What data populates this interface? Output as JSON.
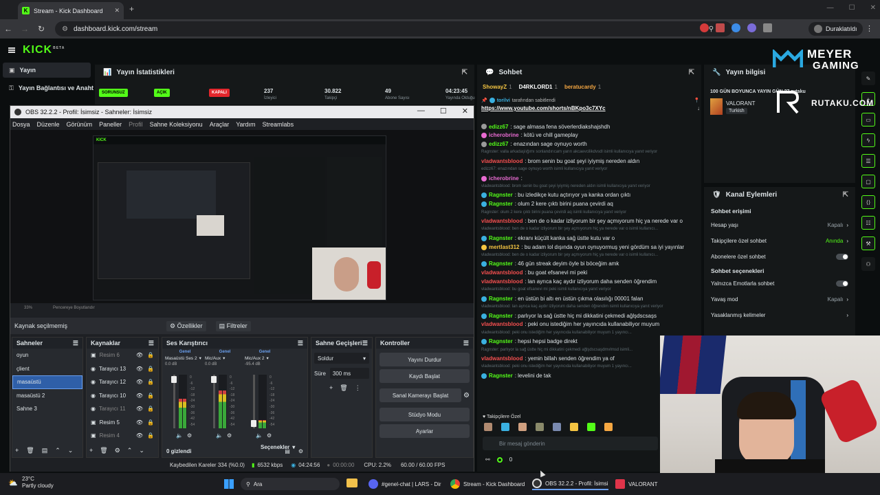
{
  "browser": {
    "tab_title": "Stream - Kick Dashboard",
    "url": "dashboard.kick.com/stream",
    "profile_label": "Duraklatıldı"
  },
  "kick": {
    "logo": "KICK",
    "logo_badge": "BETA",
    "sidebar": {
      "live": "Yayın",
      "connection": "Yayın Bağlantısı ve Anahtar"
    },
    "stats": {
      "title": "Yayın İstatistikleri",
      "badges": [
        "SORUNSUZ",
        "AÇIK",
        "KAPALI"
      ],
      "values": [
        "237",
        "30.822",
        "49",
        "04:23:45"
      ],
      "labels": [
        "İzleyici",
        "Takipçi",
        "Abone Sayısı",
        "Yayında Olduğu"
      ]
    },
    "chat": {
      "title": "Sohbet",
      "top_users": [
        "ShowayZ",
        "D4RKLORD1",
        "beratucardy"
      ],
      "top_counts": [
        "1",
        "1",
        "1"
      ],
      "pinned_by": "torilvi",
      "pinned_text": "tarafından sabitlendi",
      "pinned_link": "https://www.youtube.com/shorts/nBKpo3c7XYc",
      "messages": [
        {
          "u": "edizz67",
          "c": "#53fc18",
          "t": ": sage almasa fena söverlerdiakshajshdh",
          "ic": "#9a9a9a"
        },
        {
          "u": "icherobrine",
          "c": "#e86bd1",
          "t": ": kötü ve chill gameplay",
          "ic": "#e86bd1"
        },
        {
          "u": "edizz67",
          "c": "#53fc18",
          "t": ": enazından sage oynuyo worth",
          "ic": "#9a9a9a"
        },
        {
          "small": "Ragnster: valla arkadaşlığımı sonlandırıcam yarın akcaevcilikdvsdl isimli kullanıcıya yanıt veriyor"
        },
        {
          "u": "vladwantsblood",
          "c": "#f44f4f",
          "t": ": brom senin bu goat şeyi iyiymiş nereden aldın"
        },
        {
          "small": "edizz67: enazından sage oynuyo worth isimli kullanıcıya yanıt veriyor"
        },
        {
          "u": "icherobrine",
          "c": "#e86bd1",
          "t": ":",
          "ic": "#e86bd1"
        },
        {
          "small": "vladwantsblood: brom senin bu goat şeyi iyiymiş nereden aldın isimli kullanıcıya yanıt veriyor"
        },
        {
          "u": "Ragnster",
          "c": "#53fc18",
          "t": ": bu izledikçe kutu açtırıyor ya kanka ordan çıktı",
          "ic": "#3ab0e0"
        },
        {
          "u": "Ragnster",
          "c": "#53fc18",
          "t": ": olum 2 kere çıktı birini puana çevirdi aq",
          "ic": "#3ab0e0"
        },
        {
          "small": "Ragnster: olum 2 kere çıktı birini puana çevirdi aq isimli kullanıcıya yanıt veriyor"
        },
        {
          "u": "vladwantsblood",
          "c": "#f44f4f",
          "t": ": ben de o kadar izliyorum bir şey açmıyorum hiç ya nerede var o"
        },
        {
          "small": "vladwantsblood: ben de o kadar izliyorum bir şey açmıyorum hiç ya nerede var o isimli kullanıcı..."
        },
        {
          "u": "Ragnster",
          "c": "#53fc18",
          "t": ": ekranı küçült kanka sağ üstte kutu var o",
          "ic": "#3ab0e0"
        },
        {
          "u": "mertlast312",
          "c": "#f5c542",
          "t": ": bu adam lol dışında oyun oynuyormuş yeni gördüm sa iyi yayınlar",
          "ic": "#f5c542"
        },
        {
          "small": "vladwantsblood: ben de o kadar izliyorum bir şey açmıyorum hiç ya nerede var o isimli kullanıcı..."
        },
        {
          "u": "Ragnster",
          "c": "#53fc18",
          "t": ": 46 gün streak deyim öyle bi böceğim amk",
          "ic": "#3ab0e0"
        },
        {
          "u": "vladwantsblood",
          "c": "#f44f4f",
          "t": ": bu goat efsanevi mi peki"
        },
        {
          "u": "vladwantsblood",
          "c": "#f44f4f",
          "t": ": lan ayrıca kaç aydır izliyorum daha senden öğrendim"
        },
        {
          "small": "vladwantsblood: bu goat efsanevi mi peki isimli kullanıcıya yanıt veriyor"
        },
        {
          "u": "Ragnster",
          "c": "#53fc18",
          "t": ": en üstün bi altı en üstün çıkma olasılığı 00001 falan",
          "ic": "#3ab0e0"
        },
        {
          "small": "vladwantsblood: lan ayrıca kaç aydır izliyorum daha senden öğrendim isimli kullanıcıya yanıt veriyor"
        },
        {
          "u": "Ragnster",
          "c": "#53fc18",
          "t": ": parlıyor la sağ üstte hiç mi dikkatini çekmedi ağlşdscsaşs",
          "ic": "#3ab0e0"
        },
        {
          "u": "vladwantsblood",
          "c": "#f44f4f",
          "t": ": peki onu istediğim her yayıncıda kullanabiliyor muyum"
        },
        {
          "small": "vladwantsblood: peki onu istediğim her yayıncıda kullanabiliyor muyum 1 yayıncı..."
        },
        {
          "u": "Ragnster",
          "c": "#53fc18",
          "t": ": hepsi hepsi badge direkt",
          "ic": "#3ab0e0"
        },
        {
          "small": "Ragnster: parlıyor la sağ üstte hiç mi dikkatini çekmedi ağlşdscsaşdmvlmsd isimli..."
        },
        {
          "u": "vladwantsblood",
          "c": "#f44f4f",
          "t": ": yemin billah senden öğrendim ya of"
        },
        {
          "small": "vladwantsblood: peki onu istediğim her yayıncıda kullanabiliyor muyum 1 yayıncı..."
        },
        {
          "u": "Ragnster",
          "c": "#53fc18",
          "t": ": levelini de tak",
          "ic": "#3ab0e0"
        }
      ],
      "followers_label": "Takipçilere Özel",
      "input_placeholder": "Bir mesaj gönderin",
      "viewer_count": "0"
    },
    "info": {
      "title": "Yayın bilgisi",
      "stream_title": "100 GÜN BOYUNCA YAYIN GÜN 27 rutaku",
      "category": "VALORANT",
      "language": "Turkish"
    },
    "actions": {
      "title": "Kanal Eylemleri",
      "section1": "Sohbet erişimi",
      "rows1": [
        {
          "label": "Hesap yaşı",
          "value": "Kapalı"
        },
        {
          "label": "Takipçilere özel sohbet",
          "value": "Anında"
        },
        {
          "label": "Abonelere özel sohbet",
          "value": ""
        }
      ],
      "section2": "Sohbet seçenekleri",
      "rows2": [
        {
          "label": "Yalnızca Emotlarla sohbet",
          "value": ""
        },
        {
          "label": "Yavaş mod",
          "value": "Kapalı"
        },
        {
          "label": "Yasaklanmış kelimeler",
          "value": ""
        }
      ]
    }
  },
  "overlay": {
    "meyer_top": "MEYER",
    "meyer_bottom": "GAMING",
    "rutaku": "RUTAKU.COM"
  },
  "obs": {
    "title": "OBS 32.2.2 - Profil: İsimsiz - Sahneler: İsimsiz",
    "menu": [
      "Dosya",
      "Düzenle",
      "Görünüm",
      "Paneller",
      "Profil",
      "Sahne Koleksiyonu",
      "Araçlar",
      "Yardım",
      "Streamlabs"
    ],
    "zoom": "33%",
    "fit_label": "Pencereye Boyutlandır",
    "no_source": "Kaynak seçilmemiş",
    "properties": "Özellikler",
    "filters": "Filtreler",
    "scenes_title": "Sahneler",
    "scenes": [
      "oyun",
      "çlient",
      "masaüstü",
      "masaüstü 2",
      "Sahne 3"
    ],
    "sources_title": "Kaynaklar",
    "sources": [
      "Resim 6",
      "Tarayıcı 13",
      "Tarayıcı 12",
      "Tarayıcı 10",
      "Tarayıcı 11",
      "Resim 5",
      "Resim 4"
    ],
    "mixer_title": "Ses Karıştırıcı",
    "mixer_channels": [
      {
        "tag": "Genel",
        "name": "Masaüstü Ses 2",
        "db": "0.0 dB",
        "level": 0.55
      },
      {
        "tag": "Genel",
        "name": "Mic/Aux",
        "db": "0.0 dB",
        "level": 0.7
      },
      {
        "tag": "Genel",
        "name": "Mic/Aux 2",
        "db": "-95.4 dB",
        "level": 0.15
      }
    ],
    "hidden_label": "0 gizlendi",
    "transitions_title": "Sahne Geçişleri",
    "transition": "Soldur",
    "duration_label": "Süre",
    "duration": "300 ms",
    "controls_title": "Kontroller",
    "buttons": [
      "Yayını Durdur",
      "Kaydı Başlat",
      "Sanal Kamerayı Başlat",
      "Stüdyo Modu",
      "Ayarlar"
    ],
    "options_label": "Seçenekler",
    "footer": {
      "dropped": "Kaybedilen Kareler 334 (%0.0)",
      "bitrate": "6532 kbps",
      "live_time": "04:24:56",
      "rec_time": "00:00:00",
      "cpu": "CPU: 2.2%",
      "fps": "60.00 / 60.00 FPS"
    }
  },
  "taskbar": {
    "weather_temp": "23°C",
    "weather_text": "Partly cloudy",
    "search": "Ara",
    "items": [
      "#genel-chat | LARS - Dir",
      "Stream - Kick Dashboard",
      "OBS 32.2.2 - Profil: İsimsi",
      "VALORANT"
    ]
  },
  "colors": {
    "kick_green": "#53fc18",
    "obs_select": "#2f5fa8",
    "red_badge": "#e3262c"
  }
}
